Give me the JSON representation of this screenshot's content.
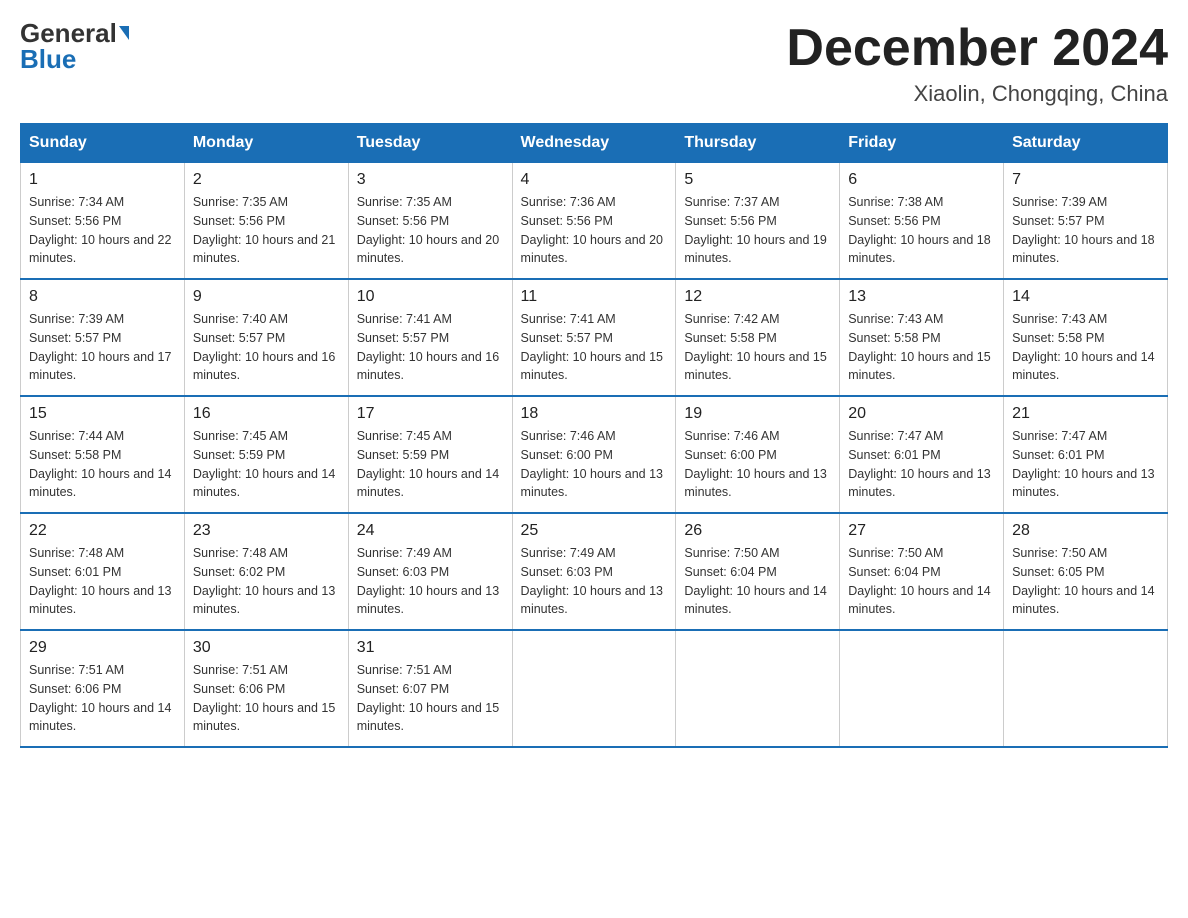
{
  "logo": {
    "general": "General",
    "blue": "Blue"
  },
  "title": {
    "month_year": "December 2024",
    "location": "Xiaolin, Chongqing, China"
  },
  "weekdays": [
    "Sunday",
    "Monday",
    "Tuesday",
    "Wednesday",
    "Thursday",
    "Friday",
    "Saturday"
  ],
  "weeks": [
    [
      {
        "day": "1",
        "sunrise": "7:34 AM",
        "sunset": "5:56 PM",
        "daylight": "10 hours and 22 minutes."
      },
      {
        "day": "2",
        "sunrise": "7:35 AM",
        "sunset": "5:56 PM",
        "daylight": "10 hours and 21 minutes."
      },
      {
        "day": "3",
        "sunrise": "7:35 AM",
        "sunset": "5:56 PM",
        "daylight": "10 hours and 20 minutes."
      },
      {
        "day": "4",
        "sunrise": "7:36 AM",
        "sunset": "5:56 PM",
        "daylight": "10 hours and 20 minutes."
      },
      {
        "day": "5",
        "sunrise": "7:37 AM",
        "sunset": "5:56 PM",
        "daylight": "10 hours and 19 minutes."
      },
      {
        "day": "6",
        "sunrise": "7:38 AM",
        "sunset": "5:56 PM",
        "daylight": "10 hours and 18 minutes."
      },
      {
        "day": "7",
        "sunrise": "7:39 AM",
        "sunset": "5:57 PM",
        "daylight": "10 hours and 18 minutes."
      }
    ],
    [
      {
        "day": "8",
        "sunrise": "7:39 AM",
        "sunset": "5:57 PM",
        "daylight": "10 hours and 17 minutes."
      },
      {
        "day": "9",
        "sunrise": "7:40 AM",
        "sunset": "5:57 PM",
        "daylight": "10 hours and 16 minutes."
      },
      {
        "day": "10",
        "sunrise": "7:41 AM",
        "sunset": "5:57 PM",
        "daylight": "10 hours and 16 minutes."
      },
      {
        "day": "11",
        "sunrise": "7:41 AM",
        "sunset": "5:57 PM",
        "daylight": "10 hours and 15 minutes."
      },
      {
        "day": "12",
        "sunrise": "7:42 AM",
        "sunset": "5:58 PM",
        "daylight": "10 hours and 15 minutes."
      },
      {
        "day": "13",
        "sunrise": "7:43 AM",
        "sunset": "5:58 PM",
        "daylight": "10 hours and 15 minutes."
      },
      {
        "day": "14",
        "sunrise": "7:43 AM",
        "sunset": "5:58 PM",
        "daylight": "10 hours and 14 minutes."
      }
    ],
    [
      {
        "day": "15",
        "sunrise": "7:44 AM",
        "sunset": "5:58 PM",
        "daylight": "10 hours and 14 minutes."
      },
      {
        "day": "16",
        "sunrise": "7:45 AM",
        "sunset": "5:59 PM",
        "daylight": "10 hours and 14 minutes."
      },
      {
        "day": "17",
        "sunrise": "7:45 AM",
        "sunset": "5:59 PM",
        "daylight": "10 hours and 14 minutes."
      },
      {
        "day": "18",
        "sunrise": "7:46 AM",
        "sunset": "6:00 PM",
        "daylight": "10 hours and 13 minutes."
      },
      {
        "day": "19",
        "sunrise": "7:46 AM",
        "sunset": "6:00 PM",
        "daylight": "10 hours and 13 minutes."
      },
      {
        "day": "20",
        "sunrise": "7:47 AM",
        "sunset": "6:01 PM",
        "daylight": "10 hours and 13 minutes."
      },
      {
        "day": "21",
        "sunrise": "7:47 AM",
        "sunset": "6:01 PM",
        "daylight": "10 hours and 13 minutes."
      }
    ],
    [
      {
        "day": "22",
        "sunrise": "7:48 AM",
        "sunset": "6:01 PM",
        "daylight": "10 hours and 13 minutes."
      },
      {
        "day": "23",
        "sunrise": "7:48 AM",
        "sunset": "6:02 PM",
        "daylight": "10 hours and 13 minutes."
      },
      {
        "day": "24",
        "sunrise": "7:49 AM",
        "sunset": "6:03 PM",
        "daylight": "10 hours and 13 minutes."
      },
      {
        "day": "25",
        "sunrise": "7:49 AM",
        "sunset": "6:03 PM",
        "daylight": "10 hours and 13 minutes."
      },
      {
        "day": "26",
        "sunrise": "7:50 AM",
        "sunset": "6:04 PM",
        "daylight": "10 hours and 14 minutes."
      },
      {
        "day": "27",
        "sunrise": "7:50 AM",
        "sunset": "6:04 PM",
        "daylight": "10 hours and 14 minutes."
      },
      {
        "day": "28",
        "sunrise": "7:50 AM",
        "sunset": "6:05 PM",
        "daylight": "10 hours and 14 minutes."
      }
    ],
    [
      {
        "day": "29",
        "sunrise": "7:51 AM",
        "sunset": "6:06 PM",
        "daylight": "10 hours and 14 minutes."
      },
      {
        "day": "30",
        "sunrise": "7:51 AM",
        "sunset": "6:06 PM",
        "daylight": "10 hours and 15 minutes."
      },
      {
        "day": "31",
        "sunrise": "7:51 AM",
        "sunset": "6:07 PM",
        "daylight": "10 hours and 15 minutes."
      },
      null,
      null,
      null,
      null
    ]
  ]
}
